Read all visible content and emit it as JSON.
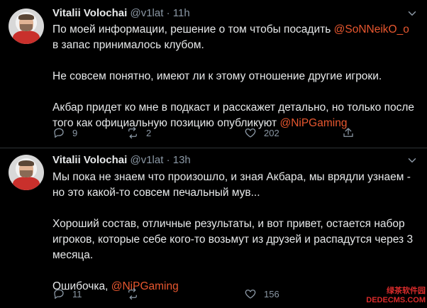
{
  "tweets": [
    {
      "author_name": "Vitalii Volochai",
      "author_handle": "@v1lat",
      "separator": "·",
      "time": "11h",
      "paragraphs": [
        {
          "before": "По моей информации, решение о том чтобы посадить ",
          "mention": "@SoNNeikO_o",
          "after": " в запас принималось клубом."
        },
        {
          "before": "Не совсем понятно, имеют ли к этому отношение другие игроки.",
          "mention": "",
          "after": ""
        },
        {
          "before": "Акбар придет ко мне в подкаст и расскажет детально, но только после того как официальную позицию опубликуют ",
          "mention": "@NiPGaming",
          "after": ""
        }
      ],
      "replies": "9",
      "retweets": "2",
      "likes": "202"
    },
    {
      "author_name": "Vitalii Volochai",
      "author_handle": "@v1lat",
      "separator": "·",
      "time": "13h",
      "paragraphs": [
        {
          "before": "Мы пока не знаем что произошло, и зная Акбара, мы врядли узнаем - но это какой-то совсем печальный мув...",
          "mention": "",
          "after": ""
        },
        {
          "before": "Хороший состав, отличные результаты, и вот привет, остается набор игроков, которые себе кого-то возьмут из друзей и распадутся через 3 месяца.",
          "mention": "",
          "after": ""
        },
        {
          "before": "Ошибочка, ",
          "mention": "@NiPGaming",
          "after": ""
        }
      ],
      "replies": "11",
      "retweets": "",
      "likes": "156"
    }
  ],
  "watermark": {
    "line1": "绿茶软件园",
    "line2": "DEDECMS.COM"
  },
  "colors": {
    "background": "#000000",
    "mention": "#e8572f",
    "muted": "#8b98a5",
    "divider": "#2f3336"
  },
  "icons": {
    "reply": "reply-icon",
    "retweet": "retweet-icon",
    "like": "heart-icon",
    "share": "share-icon",
    "more": "chevron-down-icon"
  }
}
